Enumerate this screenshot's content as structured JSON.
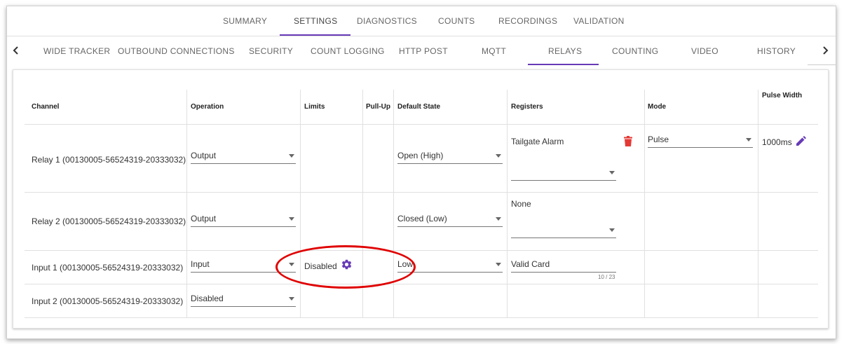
{
  "top_tabs": [
    {
      "label": "SUMMARY"
    },
    {
      "label": "SETTINGS",
      "active": true
    },
    {
      "label": "DIAGNOSTICS"
    },
    {
      "label": "COUNTS"
    },
    {
      "label": "RECORDINGS"
    },
    {
      "label": "VALIDATION"
    }
  ],
  "sub_tabs": [
    {
      "label": "WIDE TRACKER"
    },
    {
      "label": "OUTBOUND CONNECTIONS"
    },
    {
      "label": "SECURITY"
    },
    {
      "label": "COUNT LOGGING"
    },
    {
      "label": "HTTP POST"
    },
    {
      "label": "MQTT"
    },
    {
      "label": "RELAYS",
      "active": true
    },
    {
      "label": "COUNTING"
    },
    {
      "label": "VIDEO"
    },
    {
      "label": "HISTORY"
    }
  ],
  "icons": {
    "prev": "chevron-left-icon",
    "next": "chevron-right-icon",
    "delete": "trash-icon",
    "edit": "pencil-icon",
    "settings": "gear-icon"
  },
  "colors": {
    "accent": "#673ab7",
    "delete": "#e53935",
    "highlight": "#e00000"
  },
  "table": {
    "headers": {
      "channel": "Channel",
      "operation": "Operation",
      "limits": "Limits",
      "pullup": "Pull-Up",
      "default_state": "Default State",
      "registers": "Registers",
      "mode": "Mode",
      "pulse_width": "Pulse Width"
    },
    "rows": [
      {
        "channel": "Relay 1 (00130005-56524319-20333032)",
        "operation": "Output",
        "default_state": "Open (High)",
        "register_value": "Tailgate Alarm",
        "register_select": "",
        "mode": "Pulse",
        "pulse_width": "1000ms"
      },
      {
        "channel": "Relay 2 (00130005-56524319-20333032)",
        "operation": "Output",
        "default_state": "Closed (Low)",
        "register_value": "None",
        "register_select": ""
      },
      {
        "channel": "Input 1 (00130005-56524319-20333032)",
        "operation": "Input",
        "limits": "Disabled",
        "default_state": "Low",
        "register_value": "Valid Card",
        "register_counter": "10 / 23"
      },
      {
        "channel": "Input 2 (00130005-56524319-20333032)",
        "operation": "Disabled"
      }
    ]
  }
}
